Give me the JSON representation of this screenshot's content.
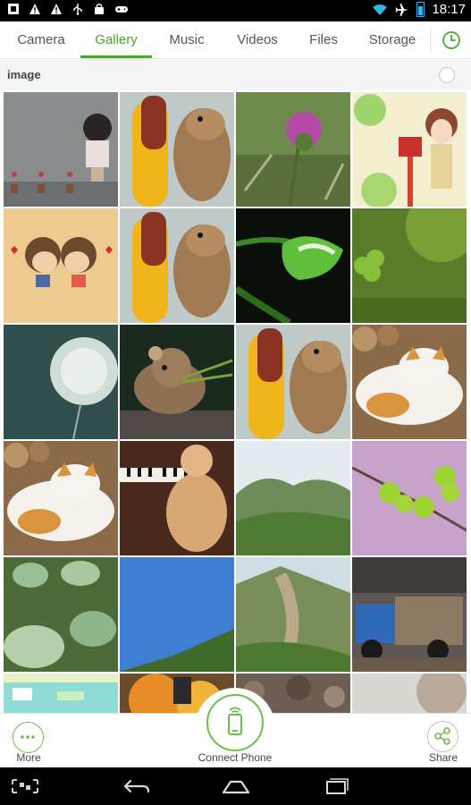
{
  "status_bar": {
    "time": "18:17",
    "left_icons": [
      "notification-icon",
      "warning-icon",
      "warning-icon",
      "usb-icon",
      "bag-icon",
      "game-controller-icon"
    ],
    "right_icons": [
      "wifi-icon",
      "airplane-icon",
      "battery-icon"
    ]
  },
  "tabs": [
    {
      "label": "Camera",
      "active": false
    },
    {
      "label": "Gallery",
      "active": true
    },
    {
      "label": "Music",
      "active": false
    },
    {
      "label": "Videos",
      "active": false
    },
    {
      "label": "Files",
      "active": false
    },
    {
      "label": "Storage",
      "active": false
    }
  ],
  "history_icon": "clock-icon",
  "section": {
    "title": "image"
  },
  "gallery": {
    "thumbnails": [
      {
        "subject": "cartoon girl with plants"
      },
      {
        "subject": "chipmunk with corn"
      },
      {
        "subject": "thistle flower"
      },
      {
        "subject": "cartoon girl with mailbox"
      },
      {
        "subject": "kissing cartoon couple"
      },
      {
        "subject": "chipmunk with corn"
      },
      {
        "subject": "green tulip"
      },
      {
        "subject": "clover on moss"
      },
      {
        "subject": "dandelion seed head"
      },
      {
        "subject": "pika with grass"
      },
      {
        "subject": "chipmunk with corn"
      },
      {
        "subject": "sleeping cat on logs"
      },
      {
        "subject": "sleeping cat on logs"
      },
      {
        "subject": "puppy at piano"
      },
      {
        "subject": "green mountains"
      },
      {
        "subject": "green buds on pink"
      },
      {
        "subject": "cabbage field"
      },
      {
        "subject": "blue sky over hill"
      },
      {
        "subject": "mountain valley"
      },
      {
        "subject": "old truck"
      },
      {
        "subject": "game screenshot"
      },
      {
        "subject": "explosion"
      },
      {
        "subject": "rocky ground"
      },
      {
        "subject": "blurry photo"
      }
    ]
  },
  "actions": {
    "more_label": "More",
    "connect_label": "Connect Phone",
    "share_label": "Share"
  },
  "colors": {
    "accent": "#4aa82d",
    "ring": "#6cbf4a",
    "status_bar": "#000000",
    "nav_bar": "#000000"
  },
  "nav": [
    "qr-scan-icon",
    "back-icon",
    "home-icon",
    "recent-apps-icon"
  ]
}
